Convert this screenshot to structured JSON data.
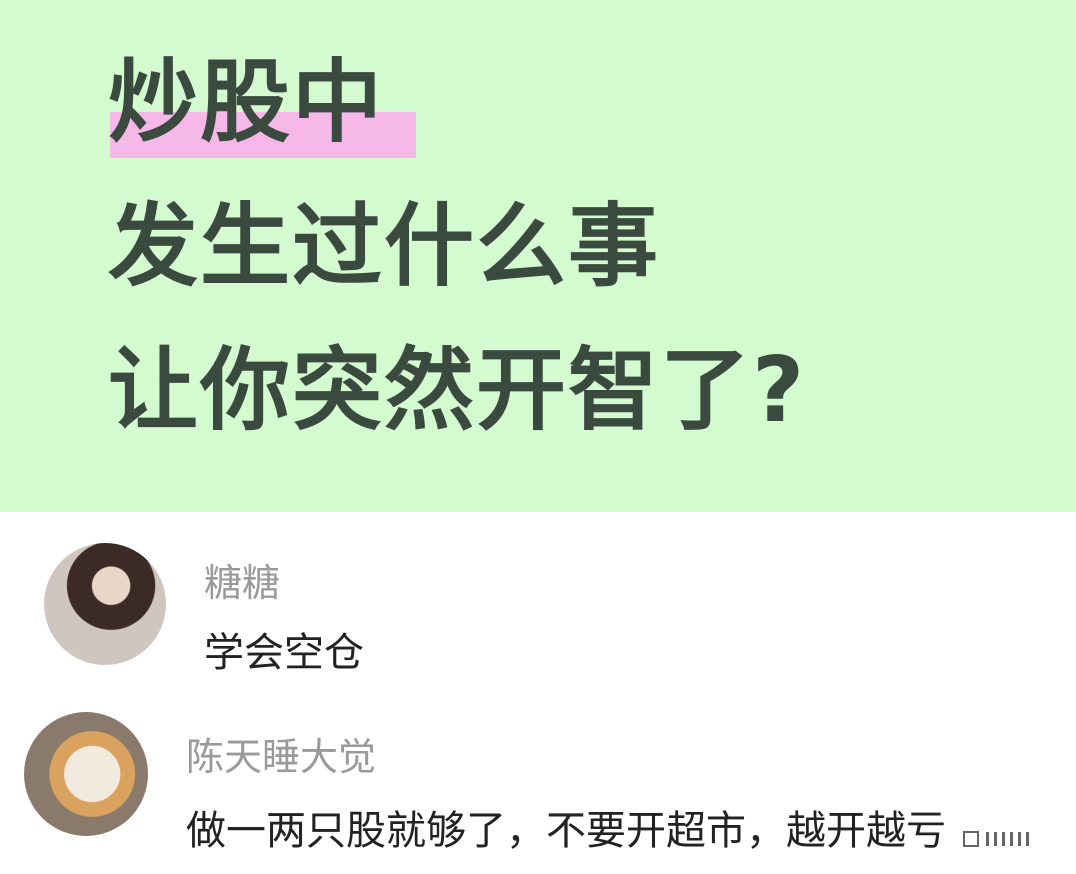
{
  "banner": {
    "line1": "炒股中",
    "line2": "发生过什么事",
    "line3": "让你突然开智了?"
  },
  "comments": [
    {
      "username": "糖糖",
      "text": "学会空仓"
    },
    {
      "username": "陈天睡大觉",
      "text": "做一两只股就够了，不要开超市，越开越亏"
    }
  ],
  "colors": {
    "banner_bg": "#d4fad0",
    "highlight": "#f6b7e9",
    "headline": "#3b4a3f",
    "username": "#9a9a9a",
    "comment_text": "#222222"
  }
}
